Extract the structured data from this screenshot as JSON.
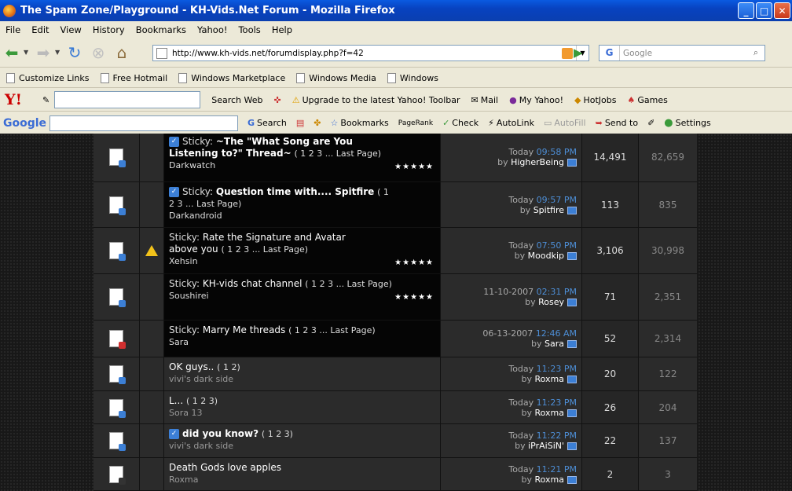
{
  "window": {
    "title": "The Spam Zone/Playground - KH-Vids.Net Forum - Mozilla Firefox"
  },
  "menu": [
    "File",
    "Edit",
    "View",
    "History",
    "Bookmarks",
    "Yahoo!",
    "Tools",
    "Help"
  ],
  "nav": {
    "url": "http://www.kh-vids.net/forumdisplay.php?f=42",
    "search_placeholder": "Google"
  },
  "bookmarks": [
    "Customize Links",
    "Free Hotmail",
    "Windows Marketplace",
    "Windows Media",
    "Windows"
  ],
  "yahoo_toolbar": {
    "search_label": "Search Web",
    "upgrade_label": "Upgrade to the latest Yahoo! Toolbar",
    "mail_label": "Mail",
    "my_yahoo_label": "My Yahoo!",
    "hotjobs_label": "HotJobs",
    "games_label": "Games"
  },
  "google_toolbar": {
    "logo": "Google",
    "search_label": "Search",
    "bookmarks_label": "Bookmarks",
    "pagerank_label": "PageRank",
    "check_label": "Check",
    "autolink_label": "AutoLink",
    "autofill_label": "AutoFill",
    "sendto_label": "Send to",
    "settings_label": "Settings"
  },
  "threads": [
    {
      "sticky": true,
      "prefix": "Sticky: ",
      "title": "~The \"What Song are You Listening to?\" Thread~",
      "title_bold": true,
      "pages": "( 1 2 3 ... Last Page)",
      "author": "Darkwatch",
      "badges": [
        "STICKY"
      ],
      "stars": "★★★★★",
      "sub_icon": true,
      "last_date": "Today",
      "last_time": "09:58 PM",
      "last_by": "HigherBeing",
      "replies": "14,491",
      "views": "82,659"
    },
    {
      "sticky": true,
      "prefix": "Sticky: ",
      "title": "Question time with.... Spitfire",
      "title_bold": true,
      "pages": "( 1 2 3 ... Last Page)",
      "author": "Darkandroid",
      "badges": [
        "STICKY"
      ],
      "stars": "",
      "sub_icon": true,
      "last_date": "Today",
      "last_time": "09:57 PM",
      "last_by": "Spitfire",
      "replies": "113",
      "views": "835"
    },
    {
      "sticky": true,
      "prefix": "Sticky: ",
      "title": "Rate the Signature and Avatar above you",
      "title_bold": false,
      "pages": "( 1 2 3 ... Last Page)",
      "author": "Xehsin",
      "badges": [
        "ATTACH",
        "STICKY"
      ],
      "stars": "★★★★★",
      "sub_icon": false,
      "warn": true,
      "last_date": "Today",
      "last_time": "07:50 PM",
      "last_by": "Moodkip",
      "replies": "3,106",
      "views": "30,998"
    },
    {
      "sticky": true,
      "prefix": "Sticky: ",
      "title": "KH-vids chat channel",
      "title_bold": false,
      "pages": "( 1 2 3 ... Last Page)",
      "author": "Soushirei",
      "badges": [
        "STICKY"
      ],
      "stars": "★★★★★",
      "sub_icon": false,
      "last_date": "11-10-2007",
      "last_time": "02:31 PM",
      "last_by": "Rosey",
      "replies": "71",
      "views": "2,351"
    },
    {
      "sticky": true,
      "prefix": "Sticky: ",
      "title": "Marry Me threads",
      "title_bold": false,
      "pages": "( 1 2 3 ... Last Page)",
      "author": "Sara",
      "badges": [
        "STICKY"
      ],
      "stars": "",
      "sub_icon": false,
      "hot": true,
      "last_date": "06-13-2007",
      "last_time": "12:46 AM",
      "last_by": "Sara",
      "replies": "52",
      "views": "2,314"
    },
    {
      "sticky": false,
      "prefix": "",
      "title": "OK guys..",
      "title_bold": false,
      "pages": "( 1 2)",
      "author": "vivi's dark side",
      "badges": [],
      "stars": "",
      "sub_icon": false,
      "last_date": "Today",
      "last_time": "11:23 PM",
      "last_by": "Roxma",
      "replies": "20",
      "views": "122"
    },
    {
      "sticky": false,
      "prefix": "",
      "title": "L...",
      "title_bold": false,
      "pages": "( 1 2 3)",
      "author": "Sora 13",
      "badges": [],
      "stars": "",
      "sub_icon": false,
      "last_date": "Today",
      "last_time": "11:23 PM",
      "last_by": "Roxma",
      "replies": "26",
      "views": "204"
    },
    {
      "sticky": false,
      "prefix": "",
      "title": "did you know?",
      "title_bold": true,
      "pages": "( 1 2 3)",
      "author": "vivi's dark side",
      "badges": [],
      "stars": "",
      "sub_icon": true,
      "last_date": "Today",
      "last_time": "11:22 PM",
      "last_by": "iPrAiSiN'",
      "replies": "22",
      "views": "137"
    },
    {
      "sticky": false,
      "prefix": "",
      "title": "Death Gods love apples",
      "title_bold": false,
      "pages": "",
      "author": "Roxma",
      "badges": [],
      "stars": "",
      "sub_icon": false,
      "plain": true,
      "last_date": "Today",
      "last_time": "11:21 PM",
      "last_by": "Roxma",
      "replies": "2",
      "views": "3"
    }
  ]
}
